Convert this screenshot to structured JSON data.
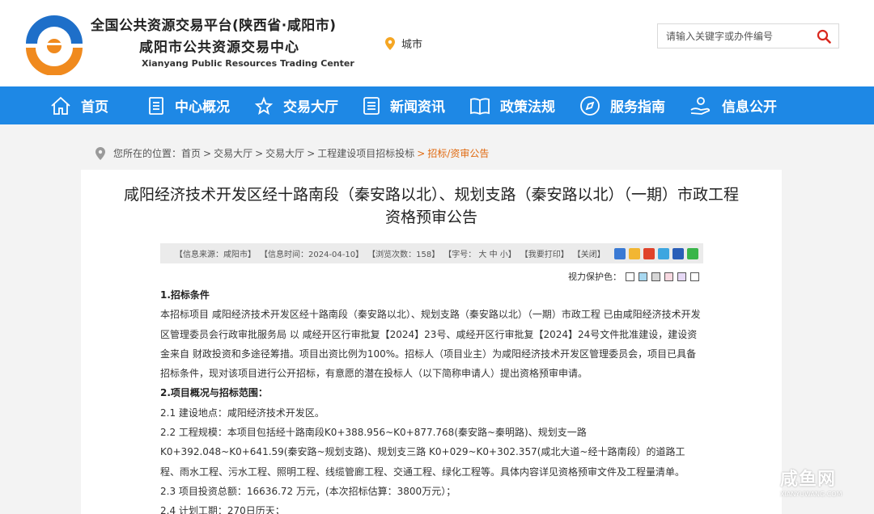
{
  "header": {
    "title_main": "全国公共资源交易平台(陕西省·咸阳市)",
    "title_sub": "咸阳市公共资源交易中心",
    "title_en": "Xianyang Public Resources Trading Center",
    "city_label": "城市"
  },
  "search": {
    "placeholder": "请输入关键字或办件编号"
  },
  "nav": {
    "items": [
      {
        "label": "首页",
        "icon": "home-icon"
      },
      {
        "label": "中心概况",
        "icon": "document-icon"
      },
      {
        "label": "交易大厅",
        "icon": "star-icon"
      },
      {
        "label": "新闻资讯",
        "icon": "news-icon"
      },
      {
        "label": "政策法规",
        "icon": "book-icon"
      },
      {
        "label": "服务指南",
        "icon": "compass-icon"
      },
      {
        "label": "信息公开",
        "icon": "hand-icon"
      }
    ]
  },
  "breadcrumb": {
    "prefix": "您所在的位置：",
    "items": [
      "首页",
      "交易大厅",
      "交易大厅",
      "工程建设项目招标投标"
    ],
    "current": "招标/资审公告"
  },
  "article": {
    "title_line1": "咸阳经济技术开发区经十路南段（秦安路以北）、规划支路（秦安路以北）（一期）市政工程",
    "title_line2": "资格预审公告",
    "toolbar": {
      "source": "【信息来源：咸阳市】",
      "time": "【信息时间：2024-04-10】",
      "views": "【浏览次数：158】",
      "font": "【字号： 大 中 小】",
      "print": "【我要打印】",
      "close": "【关闭】"
    },
    "eye_label": "视力保护色：",
    "eye_colors": [
      "#ffffff",
      "#a8d8f0",
      "#d6d6d6",
      "#f8d8e0",
      "#e6d8f5",
      "#ffffff"
    ],
    "paragraphs": [
      {
        "text": "1.招标条件",
        "heading": true
      },
      {
        "text": "本招标项目   咸阳经济技术开发区经十路南段（秦安路以北）、规划支路（秦安路以北）（一期）市政工程  已由咸阳经济技术开发区管理委员会行政审批服务局  以   咸经开区行审批复【2024】23号、咸经开区行审批复【2024】24号文件批准建设，建设资金来自   财政投资和多途径筹措。项目出资比例为100%。招标人（项目业主）为咸阳经济技术开发区管理委员会，项目已具备招标条件，现对该项目进行公开招标，有意愿的潜在投标人（以下简称申请人）提出资格预审申请。",
        "heading": false
      },
      {
        "text": "2.项目概况与招标范围：",
        "heading": true
      },
      {
        "text": "2.1  建设地点：咸阳经济技术开发区。",
        "heading": false
      },
      {
        "text": "2.2  工程规模：本项目包括经十路南段K0+388.956~K0+877.768(秦安路~秦明路)、规划支一路  K0+392.048~K0+641.59(秦安路~规划支路)、规划支三路  K0+029~K0+302.357(咸北大道~经十路南段）的道路工程、雨水工程、污水工程、照明工程、线缆管廊工程、交通工程、绿化工程等。具体内容详见资格预审文件及工程量清单。",
        "heading": false
      },
      {
        "text": "2.3  项目投资总额：16636.72 万元，(本次招标估算：3800万元）；",
        "heading": false
      },
      {
        "text": "2.4  计划工期：270日历天；",
        "heading": false
      }
    ]
  },
  "watermark": {
    "text": "咸鱼网",
    "sub": "XIANYUWANG.COM"
  },
  "colors": {
    "nav_bg": "#1e88e5",
    "accent": "#e06a10",
    "logo_blue": "#1e6fc9",
    "logo_orange": "#f08a1e"
  }
}
